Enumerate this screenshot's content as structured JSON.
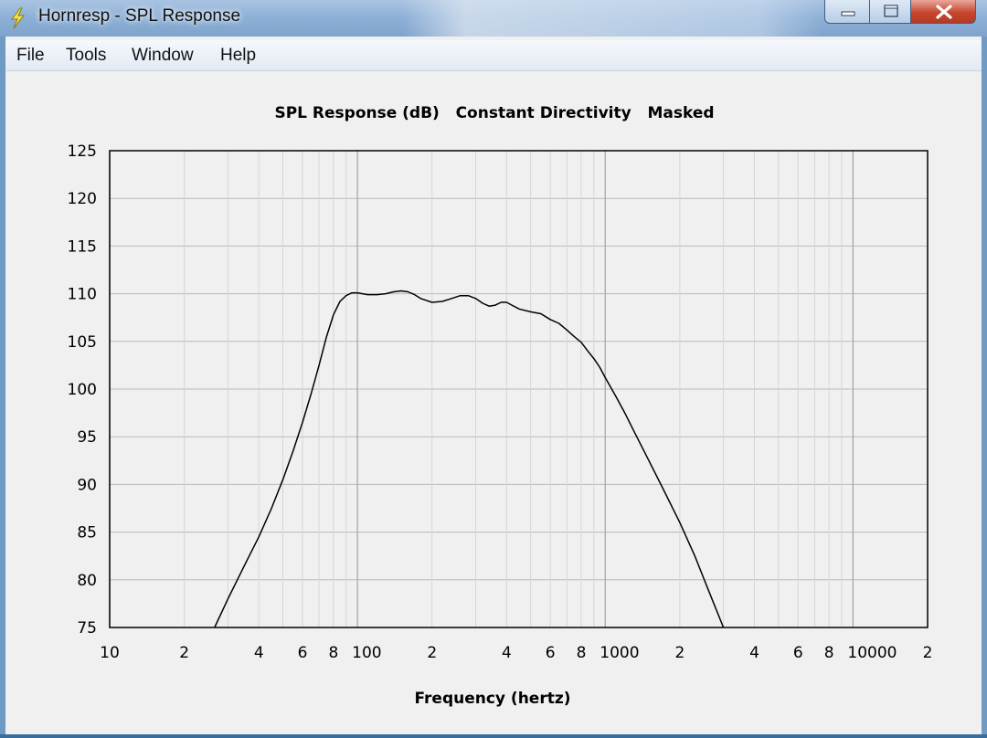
{
  "window": {
    "title": "Hornresp - SPL Response",
    "accent": "#7ea3cc"
  },
  "menu": [
    "File",
    "Tools",
    "Window",
    "Help"
  ],
  "chart_data": {
    "type": "line",
    "title": "SPL Response (dB)   Constant Directivity   Masked",
    "xlabel": "Frequency (hertz)",
    "ylabel": "",
    "xscale": "log",
    "xlim": [
      10,
      20000
    ],
    "ylim": [
      75,
      125
    ],
    "grid": true,
    "y_ticks": [
      "125",
      "120",
      "115",
      "110",
      "105",
      "100",
      "95",
      "90",
      "85",
      "80",
      "75"
    ],
    "x_tick_labels": [
      {
        "value": 10,
        "label": "10"
      },
      {
        "value": 20,
        "label": "2"
      },
      {
        "value": 40,
        "label": "4"
      },
      {
        "value": 60,
        "label": "6"
      },
      {
        "value": 80,
        "label": "8"
      },
      {
        "value": 100,
        "label": "100"
      },
      {
        "value": 200,
        "label": "2"
      },
      {
        "value": 400,
        "label": "4"
      },
      {
        "value": 600,
        "label": "6"
      },
      {
        "value": 800,
        "label": "8"
      },
      {
        "value": 1000,
        "label": "1000"
      },
      {
        "value": 2000,
        "label": "2"
      },
      {
        "value": 4000,
        "label": "4"
      },
      {
        "value": 6000,
        "label": "6"
      },
      {
        "value": 8000,
        "label": "8"
      },
      {
        "value": 10000,
        "label": "10000"
      },
      {
        "value": 20000,
        "label": "2"
      }
    ],
    "series": [
      {
        "color": "#000000",
        "x": [
          26.5,
          30,
          35,
          40,
          45,
          50,
          55,
          60,
          65,
          70,
          75,
          80,
          85,
          90,
          95,
          100,
          110,
          120,
          130,
          140,
          150,
          160,
          170,
          180,
          200,
          220,
          240,
          260,
          280,
          300,
          320,
          340,
          360,
          380,
          400,
          420,
          450,
          500,
          550,
          600,
          650,
          700,
          750,
          800,
          850,
          900,
          950,
          1000,
          1100,
          1200,
          1300,
          1500,
          1700,
          2000,
          2300,
          2600,
          3000
        ],
        "y": [
          75,
          78,
          81.5,
          84.5,
          87.5,
          90.5,
          93.5,
          96.5,
          99.5,
          102.5,
          105.5,
          107.8,
          109.2,
          109.8,
          110.1,
          110.1,
          109.9,
          109.9,
          110.0,
          110.2,
          110.3,
          110.2,
          109.9,
          109.5,
          109.1,
          109.2,
          109.5,
          109.8,
          109.8,
          109.5,
          109.0,
          108.7,
          108.8,
          109.1,
          109.1,
          108.8,
          108.4,
          108.1,
          107.9,
          107.3,
          106.9,
          106.2,
          105.5,
          104.9,
          104.0,
          103.2,
          102.3,
          101.2,
          99.3,
          97.5,
          95.7,
          92.5,
          89.7,
          86.0,
          82.5,
          79.0,
          75.0
        ]
      }
    ]
  }
}
